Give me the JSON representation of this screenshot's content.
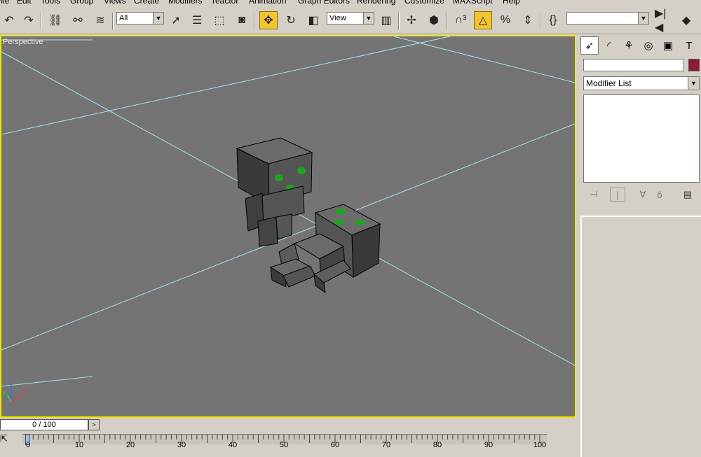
{
  "menu": [
    "File",
    "Edit",
    "Tools",
    "Group",
    "Views",
    "Create",
    "Modifiers",
    "reactor",
    "Animation",
    "Graph Editors",
    "Rendering",
    "Customize",
    "MAXScript",
    "Help"
  ],
  "toolbar": {
    "selection_filter": "All",
    "reference_coord": "View",
    "named_selection": "",
    "icons": [
      "undo-icon",
      "redo-icon",
      "link-icon",
      "unlink-icon",
      "bind-space-warp-icon",
      "select-icon",
      "select-by-name-icon",
      "rect-region-icon",
      "window-crossing-icon",
      "move-icon",
      "rotate-icon",
      "scale-icon",
      "pivot-icon",
      "manipulate-icon",
      "keyboard-shortcut-icon",
      "snap-3d-icon",
      "angle-snap-icon",
      "percent-snap-icon",
      "spinner-snap-icon",
      "edit-named-sel-icon",
      "mirror-icon",
      "align-icon"
    ]
  },
  "viewport": {
    "label": "Perspective",
    "border_color": "#f2e600",
    "background": "#747474",
    "grid_color": "#a8e0f0",
    "eye_color": "#19a81c"
  },
  "command_panel": {
    "tabs": [
      "create-tab",
      "modify-tab",
      "hierarchy-tab",
      "motion-tab",
      "display-tab",
      "utilities-tab"
    ],
    "name_value": "",
    "object_color": "#8e1a3a",
    "modifier_list": "Modifier List"
  },
  "time_slider": {
    "frame": "0 / 100"
  },
  "trackbar": {
    "ticks": [
      "0",
      "10",
      "20",
      "30",
      "40",
      "50",
      "60",
      "70",
      "80",
      "90",
      "100"
    ]
  },
  "axis": {
    "x": "x",
    "y": "y",
    "z": "z"
  }
}
